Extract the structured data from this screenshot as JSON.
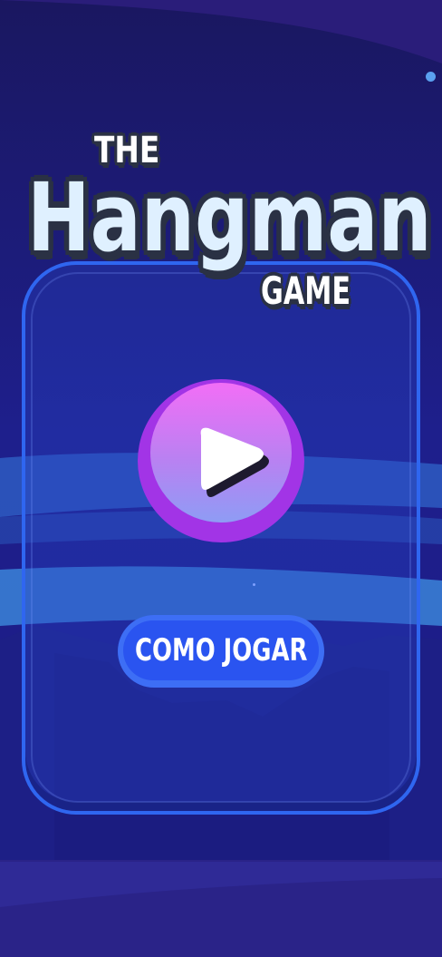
{
  "title": {
    "line1": "THE",
    "line2": "Hangman",
    "line3": "GAME"
  },
  "menu": {
    "play_icon": "play-icon",
    "howto_label": "COMO JOGAR"
  },
  "colors": {
    "background": "#1a1a6e",
    "panel_border": "#2f66f0",
    "play_button": "#a234e6",
    "howto_button": "#2a54f0",
    "title_outline": "#2a3144"
  }
}
